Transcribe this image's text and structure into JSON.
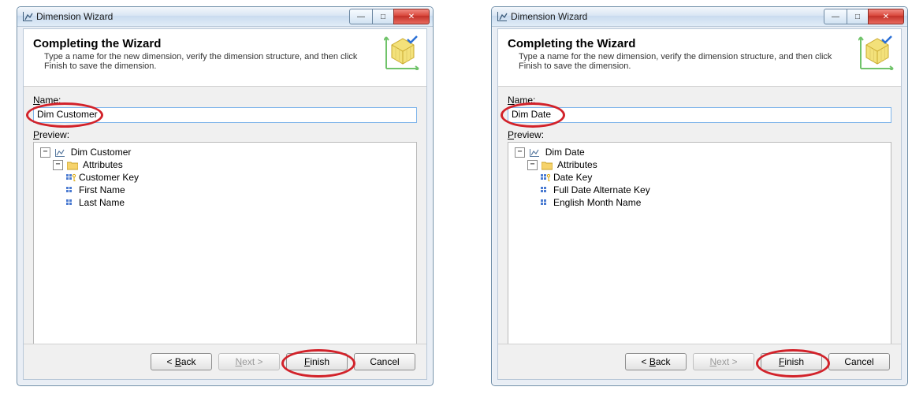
{
  "windows": [
    {
      "title": "Dimension Wizard",
      "extra_title": "",
      "header_title": "Completing the Wizard",
      "header_desc": "Type a name for the new dimension, verify the dimension structure, and then click Finish to save the dimension.",
      "name_label": "Name:",
      "name_hotkey": "N",
      "name_value": "Dim Customer",
      "preview_label": "Preview:",
      "preview_hotkey": "P",
      "tree_root": "Dim Customer",
      "attributes_label": "Attributes",
      "attributes": [
        "Customer Key",
        "First Name",
        "Last Name"
      ],
      "buttons": {
        "back": "< Back",
        "next": "Next >",
        "finish": "Finish",
        "cancel": "Cancel"
      }
    },
    {
      "title": "Dimension Wizard",
      "extra_title": "",
      "header_title": "Completing the Wizard",
      "header_desc": "Type a name for the new dimension, verify the dimension structure, and then click Finish to save the dimension.",
      "name_label": "Name:",
      "name_hotkey": "N",
      "name_value": "Dim Date",
      "preview_label": "Preview:",
      "preview_hotkey": "P",
      "tree_root": "Dim Date",
      "attributes_label": "Attributes",
      "attributes": [
        "Date Key",
        "Full Date Alternate Key",
        "English Month Name"
      ],
      "buttons": {
        "back": "< Back",
        "next": "Next >",
        "finish": "Finish",
        "cancel": "Cancel"
      }
    }
  ],
  "icons": {
    "minimize": "—",
    "maximize": "□",
    "close": "✕"
  }
}
